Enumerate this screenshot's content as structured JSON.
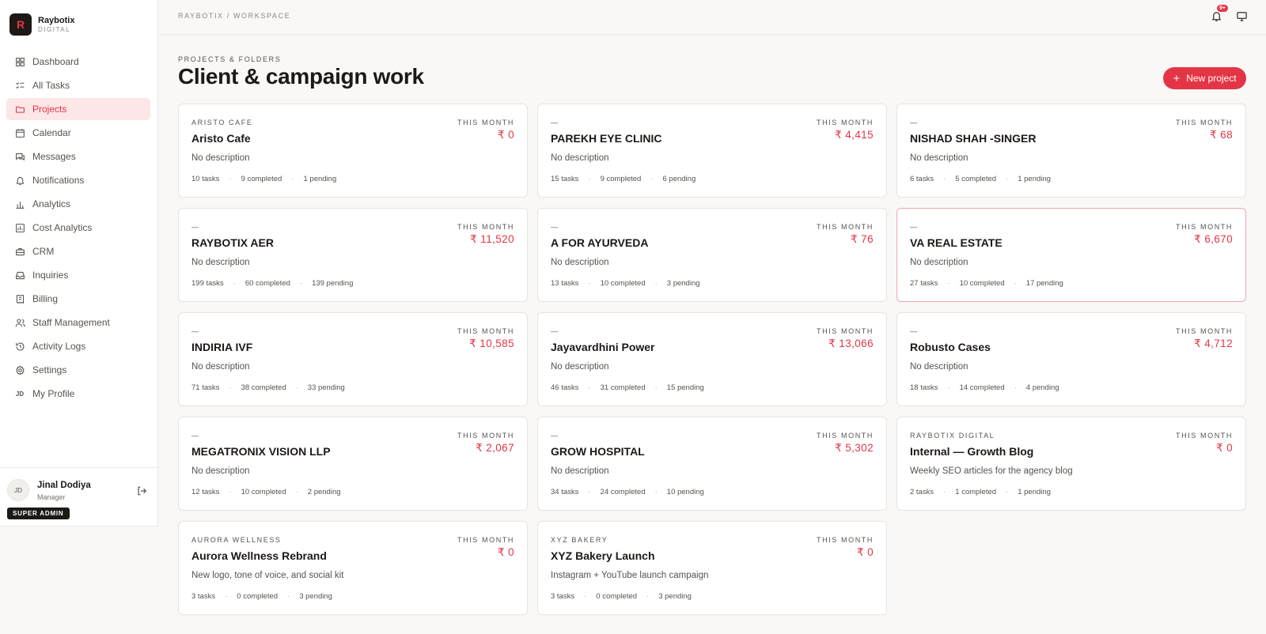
{
  "brand": {
    "logo_letter": "R",
    "name": "Raybotix",
    "sub": "DIGITAL"
  },
  "nav": [
    {
      "label": "Dashboard",
      "icon": "dashboard-icon",
      "active": false
    },
    {
      "label": "All Tasks",
      "icon": "tasks-icon",
      "active": false
    },
    {
      "label": "Projects",
      "icon": "folder-icon",
      "active": true
    },
    {
      "label": "Calendar",
      "icon": "calendar-icon",
      "active": false
    },
    {
      "label": "Messages",
      "icon": "messages-icon",
      "active": false
    },
    {
      "label": "Notifications",
      "icon": "bell-icon",
      "active": false
    },
    {
      "label": "Analytics",
      "icon": "bar-chart-icon",
      "active": false
    },
    {
      "label": "Cost Analytics",
      "icon": "cost-icon",
      "active": false
    },
    {
      "label": "CRM",
      "icon": "briefcase-icon",
      "active": false
    },
    {
      "label": "Inquiries",
      "icon": "inbox-icon",
      "active": false
    },
    {
      "label": "Billing",
      "icon": "receipt-icon",
      "active": false
    },
    {
      "label": "Staff Management",
      "icon": "users-icon",
      "active": false
    },
    {
      "label": "Activity Logs",
      "icon": "history-icon",
      "active": false
    },
    {
      "label": "Settings",
      "icon": "gear-icon",
      "active": false
    },
    {
      "label": "My Profile",
      "icon": "profile-initials-icon",
      "active": false
    }
  ],
  "user": {
    "initials": "JD",
    "name": "Jinal Dodiya",
    "role": "Manager",
    "badge": "SUPER ADMIN"
  },
  "header": {
    "breadcrumb": "RAYBOTIX / WORKSPACE",
    "notification_count": "9+"
  },
  "page": {
    "eyebrow": "PROJECTS & FOLDERS",
    "title": "Client & campaign work",
    "new_button": "New project"
  },
  "colors": {
    "accent": "#e33545",
    "dark": "#1c1917"
  },
  "projects": [
    {
      "client": "ARISTO CAFE",
      "month_label": "THIS MONTH",
      "amount": "₹ 0",
      "name": "Aristo Cafe",
      "description": "No description",
      "tasks": "10 tasks",
      "completed": "9 completed",
      "pending": "1 pending"
    },
    {
      "client": "—",
      "month_label": "THIS MONTH",
      "amount": "₹ 4,415",
      "name": "PAREKH EYE CLINIC",
      "description": "No description",
      "tasks": "15 tasks",
      "completed": "9 completed",
      "pending": "6 pending"
    },
    {
      "client": "—",
      "month_label": "THIS MONTH",
      "amount": "₹ 68",
      "name": "NISHAD SHAH -SINGER",
      "description": "No description",
      "tasks": "6 tasks",
      "completed": "5 completed",
      "pending": "1 pending"
    },
    {
      "client": "—",
      "month_label": "THIS MONTH",
      "amount": "₹ 11,520",
      "name": "RAYBOTIX AER",
      "description": "No description",
      "tasks": "199 tasks",
      "completed": "60 completed",
      "pending": "139 pending"
    },
    {
      "client": "—",
      "month_label": "THIS MONTH",
      "amount": "₹ 76",
      "name": "A FOR AYURVEDA",
      "description": "No description",
      "tasks": "13 tasks",
      "completed": "10 completed",
      "pending": "3 pending"
    },
    {
      "client": "—",
      "month_label": "THIS MONTH",
      "amount": "₹ 6,670",
      "name": "VA REAL ESTATE",
      "description": "No description",
      "tasks": "27 tasks",
      "completed": "10 completed",
      "pending": "17 pending",
      "highlight": true
    },
    {
      "client": "—",
      "month_label": "THIS MONTH",
      "amount": "₹ 10,585",
      "name": "INDIRIA IVF",
      "description": "No description",
      "tasks": "71 tasks",
      "completed": "38 completed",
      "pending": "33 pending"
    },
    {
      "client": "—",
      "month_label": "THIS MONTH",
      "amount": "₹ 13,066",
      "name": "Jayavardhini Power",
      "description": "No description",
      "tasks": "46 tasks",
      "completed": "31 completed",
      "pending": "15 pending"
    },
    {
      "client": "—",
      "month_label": "THIS MONTH",
      "amount": "₹ 4,712",
      "name": "Robusto Cases",
      "description": "No description",
      "tasks": "18 tasks",
      "completed": "14 completed",
      "pending": "4 pending"
    },
    {
      "client": "—",
      "month_label": "THIS MONTH",
      "amount": "₹ 2,067",
      "name": "MEGATRONIX VISION LLP",
      "description": "No description",
      "tasks": "12 tasks",
      "completed": "10 completed",
      "pending": "2 pending"
    },
    {
      "client": "—",
      "month_label": "THIS MONTH",
      "amount": "₹ 5,302",
      "name": "GROW HOSPITAL",
      "description": "No description",
      "tasks": "34 tasks",
      "completed": "24 completed",
      "pending": "10 pending"
    },
    {
      "client": "RAYBOTIX DIGITAL",
      "month_label": "THIS MONTH",
      "amount": "₹ 0",
      "name": "Internal — Growth Blog",
      "description": "Weekly SEO articles for the agency blog",
      "tasks": "2 tasks",
      "completed": "1 completed",
      "pending": "1 pending"
    },
    {
      "client": "AURORA WELLNESS",
      "month_label": "THIS MONTH",
      "amount": "₹ 0",
      "name": "Aurora Wellness Rebrand",
      "description": "New logo, tone of voice, and social kit",
      "tasks": "3 tasks",
      "completed": "0 completed",
      "pending": "3 pending"
    },
    {
      "client": "XYZ BAKERY",
      "month_label": "THIS MONTH",
      "amount": "₹ 0",
      "name": "XYZ Bakery Launch",
      "description": "Instagram + YouTube launch campaign",
      "tasks": "3 tasks",
      "completed": "0 completed",
      "pending": "3 pending"
    }
  ]
}
